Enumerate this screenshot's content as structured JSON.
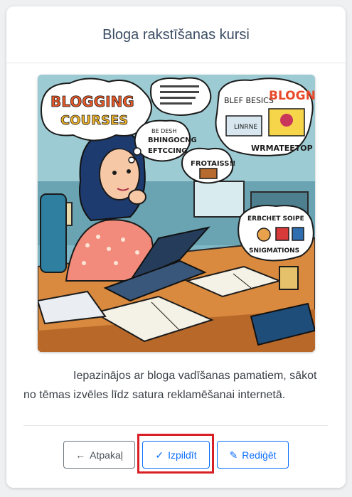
{
  "card": {
    "title": "Bloga rakstīšanas kursi",
    "description": "Iepazinājos ar bloga vadīšanas pamatiem, sākot no tēmas izvēles līdz satura reklamēšanai internetā."
  },
  "illustration": {
    "cloud_title_line1": "BLOGGING",
    "cloud_title_line2": "COURSES",
    "cloud_right_title": "BLOGN",
    "cloud_right_sub": "BLEF BESICS",
    "cloud_right_label": "LINRNE",
    "cloud_right_caption": "WRMATEETOP",
    "bubble_left_line1": "BE DESH",
    "bubble_left_line2": "BHINGOCNG",
    "bubble_left_line3": "EFTCCING",
    "bubble_center": "FROTAISS!!",
    "cloud_bottom_line1": "ERBCHET SOIPE",
    "cloud_bottom_line2": "SNIGMATIONS"
  },
  "buttons": {
    "back_label": "Atpakaļ",
    "done_label": "Izpildīt",
    "edit_label": "Rediģēt",
    "back_icon": "arrow-left-icon",
    "done_icon": "check-icon",
    "edit_icon": "pencil-icon"
  },
  "colors": {
    "primary": "#0d6efd",
    "secondary": "#6c757d",
    "highlight": "#d91f26",
    "title": "#3b4d63"
  }
}
